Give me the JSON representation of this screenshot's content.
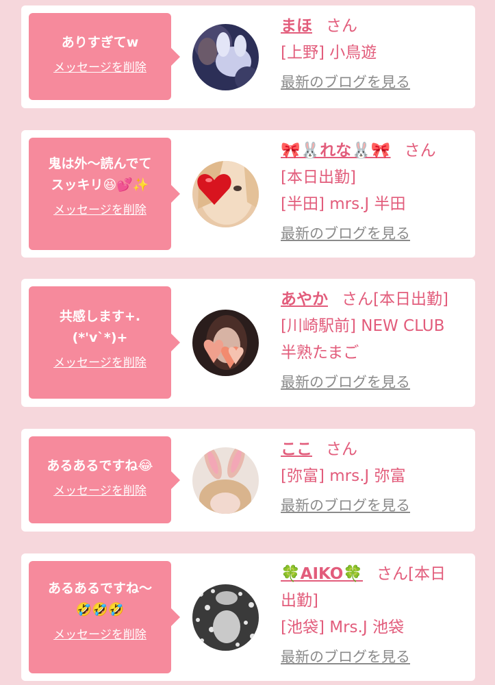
{
  "delete_label": "メッセージを削除",
  "blog_label": "最新のブログを見る",
  "colors": {
    "bubble": "#f68a9c",
    "accent": "#e25c7b",
    "link_gray": "#8a8a8a",
    "background": "#f6d7dc"
  },
  "items": [
    {
      "message": "ありすぎてw",
      "name": "まほ",
      "honorific": "さん",
      "details": [
        "[上野] 小鳥遊"
      ]
    },
    {
      "message": "鬼は外〜読んでて\nスッキリ😆💕✨",
      "name": "🎀🐰れな🐰🎀",
      "honorific": "さん",
      "details": [
        "[本日出勤]",
        "[半田] mrs.J 半田"
      ]
    },
    {
      "message": "共感します+.\n(*'v`*)+",
      "name": "あやか",
      "honorific": "さん[本日出勤]",
      "details": [
        "[川崎駅前] NEW CLUB",
        "半熟たまご"
      ]
    },
    {
      "message": "あるあるですね😂",
      "name": "ここ",
      "honorific": "さん",
      "details": [
        "[弥富] mrs.J 弥富"
      ]
    },
    {
      "message": "あるあるですね〜\n🤣🤣🤣",
      "name": "🍀AIKO🍀",
      "honorific": "さん[本日",
      "details": [
        "出勤]",
        "[池袋] Mrs.J 池袋"
      ]
    }
  ]
}
